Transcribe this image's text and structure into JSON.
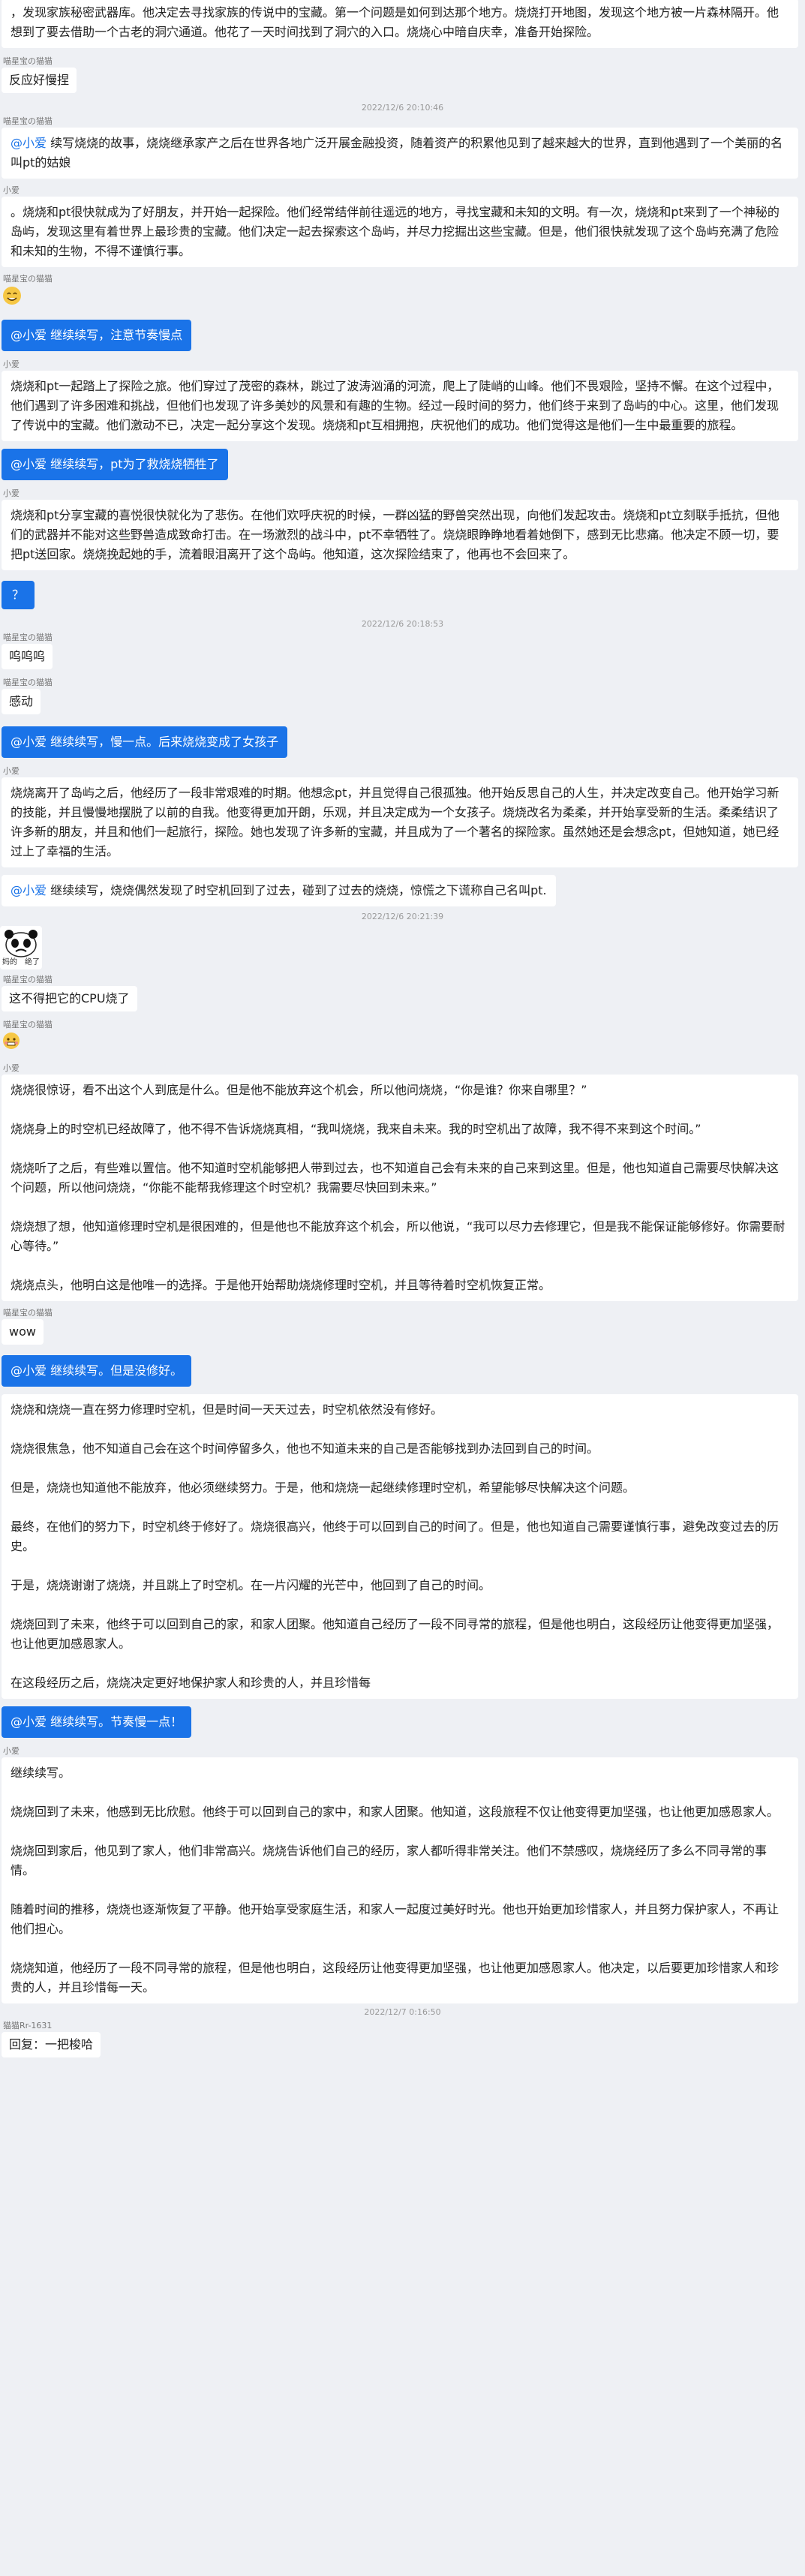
{
  "names": {
    "bot": "小爱",
    "user1": "喵星宝の猫猫",
    "user2": "猫猫Rr-1631"
  },
  "times": [
    "2022/12/6 20:10:46",
    "2022/12/6 20:18:53",
    "2022/12/6 20:21:39",
    "2022/12/7 0:16:50"
  ],
  "m0": [
    "，发现家族秘密武器库。他决定去寻找家族的传说中的宝藏。第一个问题是如何到达那个地方。烧烧打开地图，发现这个地方被一片森林隔开。他想到了要去借助一个古老的洞穴通道。他花了一天时间找到了洞穴的入口。烧烧心中暗自庆幸，准备开始探险。"
  ],
  "m1": "反应好慢捏",
  "m2": {
    "mention": "@小爱",
    "text": " 续写烧烧的故事，烧烧继承家产之后在世界各地广泛开展金融投资，随着资产的积累他见到了越来越大的世界，直到他遇到了一个美丽的名叫pt的姑娘"
  },
  "m3": [
    "。烧烧和pt很快就成为了好朋友，并开始一起探险。他们经常结伴前往遥远的地方，寻找宝藏和未知的文明。有一次，烧烧和pt来到了一个神秘的岛屿，发现这里有着世界上最珍贵的宝藏。他们决定一起去探索这个岛屿，并尽力挖掘出这些宝藏。但是，他们很快就发现了这个岛屿充满了危险和未知的生物，不得不谨慎行事。"
  ],
  "m4_sticker": "smiling-sticker",
  "m5": "@小爱 继续续写，注意节奏慢点",
  "m6": [
    "烧烧和pt一起踏上了探险之旅。他们穿过了茂密的森林，跳过了波涛汹涌的河流，爬上了陡峭的山峰。他们不畏艰险，坚持不懈。在这个过程中，他们遇到了许多困难和挑战，但他们也发现了许多美妙的风景和有趣的生物。经过一段时间的努力，他们终于来到了岛屿的中心。这里，他们发现了传说中的宝藏。他们激动不已，决定一起分享这个发现。烧烧和pt互相拥抱，庆祝他们的成功。他们觉得这是他们一生中最重要的旅程。"
  ],
  "m7": "@小爱 继续续写，pt为了救烧烧牺牲了",
  "m8": [
    "烧烧和pt分享宝藏的喜悦很快就化为了悲伤。在他们欢呼庆祝的时候，一群凶猛的野兽突然出现，向他们发起攻击。烧烧和pt立刻联手抵抗，但他们的武器并不能对这些野兽造成致命打击。在一场激烈的战斗中，pt不幸牺牲了。烧烧眼睁睁地看着她倒下，感到无比悲痛。他决定不顾一切，要把pt送回家。烧烧挽起她的手，流着眼泪离开了这个岛屿。他知道，这次探险结束了，他再也不会回来了。"
  ],
  "m9": "？",
  "m10": "呜呜呜",
  "m11": "感动",
  "m12": "@小爱 继续续写，慢一点。后来烧烧变成了女孩子",
  "m13": [
    "烧烧离开了岛屿之后，他经历了一段非常艰难的时期。他想念pt，并且觉得自己很孤独。他开始反思自己的人生，并决定改变自己。他开始学习新的技能，并且慢慢地摆脱了以前的自我。他变得更加开朗，乐观，并且决定成为一个女孩子。烧烧改名为柔柔，并开始享受新的生活。柔柔结识了许多新的朋友，并且和他们一起旅行，探险。她也发现了许多新的宝藏，并且成为了一个著名的探险家。虽然她还是会想念pt，但她知道，她已经过上了幸福的生活。"
  ],
  "m14": {
    "mention": "@小爱",
    "text": " 继续续写，烧烧偶然发现了时空机回到了过去，碰到了过去的烧烧，惊慌之下谎称自己名叫pt."
  },
  "m15_caption": "妈的　绝了",
  "m16": "这不得把它的CPU烧了",
  "m17_sticker": "grimace-sticker",
  "m18": [
    "烧烧很惊讶，看不出这个人到底是什么。但是他不能放弃这个机会，所以他问烧烧，“你是谁？你来自哪里？”",
    "烧烧身上的时空机已经故障了，他不得不告诉烧烧真相，“我叫烧烧，我来自未来。我的时空机出了故障，我不得不来到这个时间。”",
    "烧烧听了之后，有些难以置信。他不知道时空机能够把人带到过去，也不知道自己会有未来的自己来到这里。但是，他也知道自己需要尽快解决这个问题，所以他问烧烧，“你能不能帮我修理这个时空机？我需要尽快回到未来。”",
    "烧烧想了想，他知道修理时空机是很困难的，但是他也不能放弃这个机会，所以他说，“我可以尽力去修理它，但是我不能保证能够修好。你需要耐心等待。”",
    "烧烧点头，他明白这是他唯一的选择。于是他开始帮助烧烧修理时空机，并且等待着时空机恢复正常。"
  ],
  "m19": "wow",
  "m20": "@小爱 继续续写。但是没修好。",
  "m21": [
    "烧烧和烧烧一直在努力修理时空机，但是时间一天天过去，时空机依然没有修好。",
    "烧烧很焦急，他不知道自己会在这个时间停留多久，他也不知道未来的自己是否能够找到办法回到自己的时间。",
    "但是，烧烧也知道他不能放弃，他必须继续努力。于是，他和烧烧一起继续修理时空机，希望能够尽快解决这个问题。",
    "最终，在他们的努力下，时空机终于修好了。烧烧很高兴，他终于可以回到自己的时间了。但是，他也知道自己需要谨慎行事，避免改变过去的历史。",
    "于是，烧烧谢谢了烧烧，并且跳上了时空机。在一片闪耀的光芒中，他回到了自己的时间。",
    "烧烧回到了未来，他终于可以回到自己的家，和家人团聚。他知道自己经历了一段不同寻常的旅程，但是他也明白，这段经历让他变得更加坚强，也让他更加感恩家人。",
    "在这段经历之后，烧烧决定更好地保护家人和珍贵的人，并且珍惜每"
  ],
  "m22": "@小爱 继续续写。节奏慢一点！",
  "m23": [
    "继续续写。",
    "烧烧回到了未来，他感到无比欣慰。他终于可以回到自己的家中，和家人团聚。他知道，这段旅程不仅让他变得更加坚强，也让他更加感恩家人。",
    "烧烧回到家后，他见到了家人，他们非常高兴。烧烧告诉他们自己的经历，家人都听得非常关注。他们不禁感叹，烧烧经历了多么不同寻常的事情。",
    "随着时间的推移，烧烧也逐渐恢复了平静。他开始享受家庭生活，和家人一起度过美好时光。他也开始更加珍惜家人，并且努力保护家人，不再让他们担心。",
    "烧烧知道，他经历了一段不同寻常的旅程，但是他也明白，这段经历让他变得更加坚强，也让他更加感恩家人。他决定，以后要更加珍惜家人和珍贵的人，并且珍惜每一天。"
  ],
  "m24": "回复：一把梭哈"
}
